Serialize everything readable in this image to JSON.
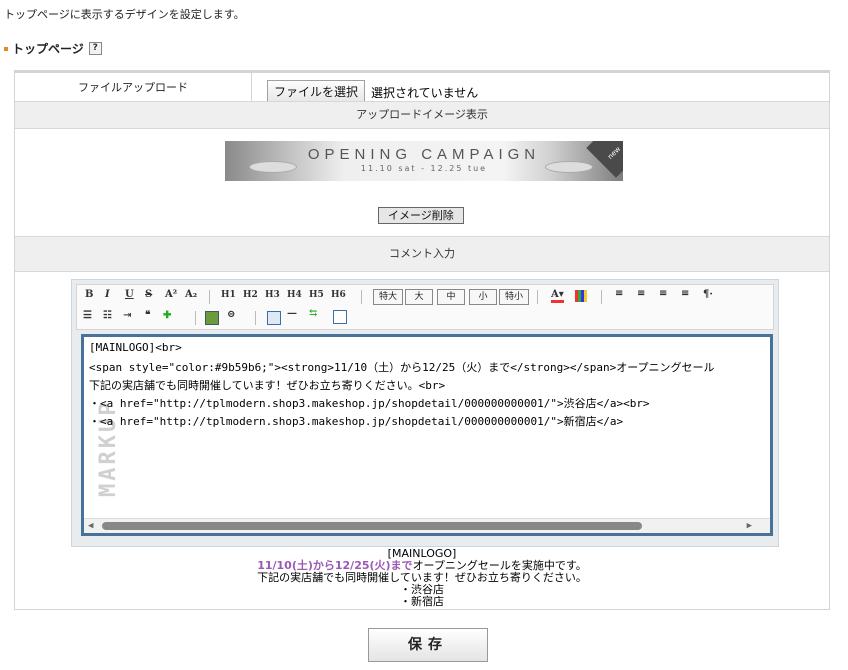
{
  "page": {
    "description": "トップページに表示するデザインを設定します。",
    "section_title": "トップページ",
    "help_icon": "?"
  },
  "upload": {
    "label": "ファイルアップロード",
    "choose_button": "ファイルを選択",
    "no_file": "選択されていません"
  },
  "image_section": {
    "header": "アップロードイメージ表示",
    "banner_line1": "OPENING CAMPAIGN",
    "banner_line2": "11.10 sat - 12.25 tue",
    "banner_badge": "new",
    "delete_button": "イメージ削除"
  },
  "comment_section": {
    "header": "コメント入力"
  },
  "toolbar": {
    "size_buttons": [
      "特大",
      "大",
      "中",
      "小",
      "特小"
    ],
    "headings": [
      "H1",
      "H2",
      "H3",
      "H4",
      "H5",
      "H6"
    ],
    "paragraph_mark": "¶·"
  },
  "editor": {
    "lines": [
      "[MAINLOGO]<br>",
      "<span style=\"color:#9b59b6;\"><strong>11/10（土）から12/25（火）まで</strong></span>オープニングセール",
      "下記の実店舗でも同時開催しています！ぜひお立ち寄りください。<br>",
      "・<a href=\"http://tplmodern.shop3.makeshop.jp/shopdetail/000000000001/\">渋谷店</a><br>",
      "・<a href=\"http://tplmodern.shop3.makeshop.jp/shopdetail/000000000001/\">新宿店</a>"
    ],
    "watermark": "MARKUP"
  },
  "preview": {
    "line1": "[MAINLOGO]",
    "line2_accent": "11/10(土)から12/25(火)まで",
    "line2_rest": "オープニングセールを実施中です。",
    "line3": "下記の実店舗でも同時開催しています！ぜひお立ち寄りください。",
    "line4": "・渋谷店",
    "line5": "・新宿店"
  },
  "save_button": "保存",
  "colors": {
    "accent": "#9b59b6",
    "editor_border": "#47739a",
    "section_bullet": "#e88a1a"
  }
}
